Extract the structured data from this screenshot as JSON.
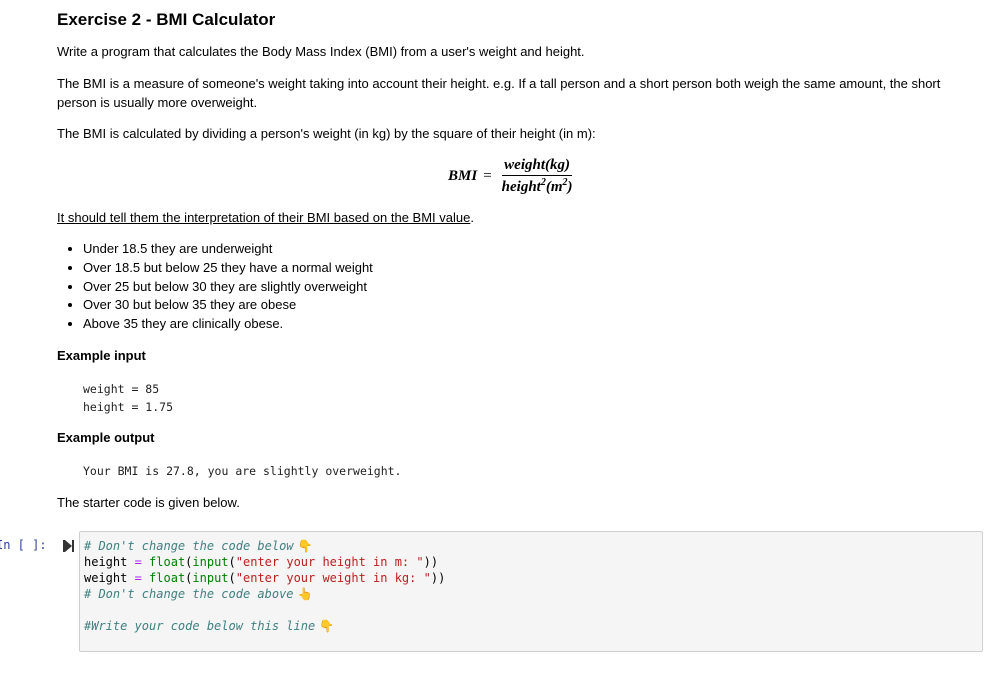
{
  "title": "Exercise 2 - BMI Calculator",
  "paragraphs": {
    "intro": "Write a program that calculates the Body Mass Index (BMI) from a user's weight and height.",
    "measure": "The BMI is a measure of someone's weight taking into account their height. e.g. If a tall person and a short person both weigh the same amount, the short person is usually more overweight.",
    "calculated": "The BMI is calculated by dividing a person's weight (in kg) by the square of their height (in m):",
    "interpretation": "It should tell them the interpretation of their BMI based on the BMI value",
    "interpretation_end": ".",
    "starter": "The starter code is given below."
  },
  "formula": {
    "lhs": "BMI",
    "eq": "=",
    "numerator": "weight(kg)",
    "denominator_base": "height",
    "denominator_sup": "2",
    "denominator_unit_open": "(m",
    "denominator_unit_sup": "2",
    "denominator_unit_close": ")"
  },
  "rules": [
    "Under 18.5 they are underweight",
    "Over 18.5 but below 25 they have a normal weight",
    "Over 25 but below 30 they are slightly overweight",
    "Over 30 but below 35 they are obese",
    "Above 35 they are clinically obese."
  ],
  "example_input": {
    "heading": "Example input",
    "lines": [
      "weight = 85",
      "height = 1.75"
    ]
  },
  "example_output": {
    "heading": "Example output",
    "text": "Your BMI is 27.8, you are slightly overweight."
  },
  "cell": {
    "prompt": "In [ ]:",
    "lines": {
      "c1": "# Don't change the code below",
      "l2_var": "height",
      "l2_eq": " = ",
      "l2_fn1": "float",
      "l2_p1": "(",
      "l2_fn2": "input",
      "l2_p2": "(",
      "l2_str": "\"enter your height in m: \"",
      "l2_close": "))",
      "l3_var": "weight",
      "l3_eq": " = ",
      "l3_fn1": "float",
      "l3_p1": "(",
      "l3_fn2": "input",
      "l3_p2": "(",
      "l3_str": "\"enter your weight in kg: \"",
      "l3_close": "))",
      "c2": "# Don't change the code above",
      "c3": "#Write your code below this line"
    },
    "emoji_down": "👇",
    "emoji_up": "👆"
  }
}
